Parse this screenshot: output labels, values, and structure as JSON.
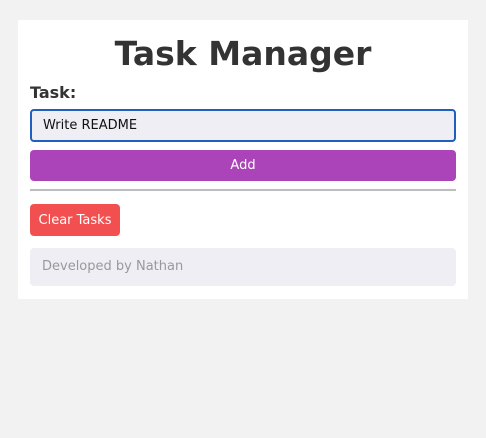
{
  "app": {
    "title": "Task Manager"
  },
  "form": {
    "task_label": "Task:",
    "task_value": "Write README",
    "add_label": "Add"
  },
  "actions": {
    "clear_label": "Clear Tasks"
  },
  "footer": {
    "text": "Developed by Nathan"
  },
  "colors": {
    "page_background": "#f2f2f2",
    "card_background": "#ffffff",
    "add_button": "#ab44b8",
    "clear_button": "#f25050",
    "input_focus_border": "#1f5fbf",
    "input_background": "#efeef4"
  }
}
